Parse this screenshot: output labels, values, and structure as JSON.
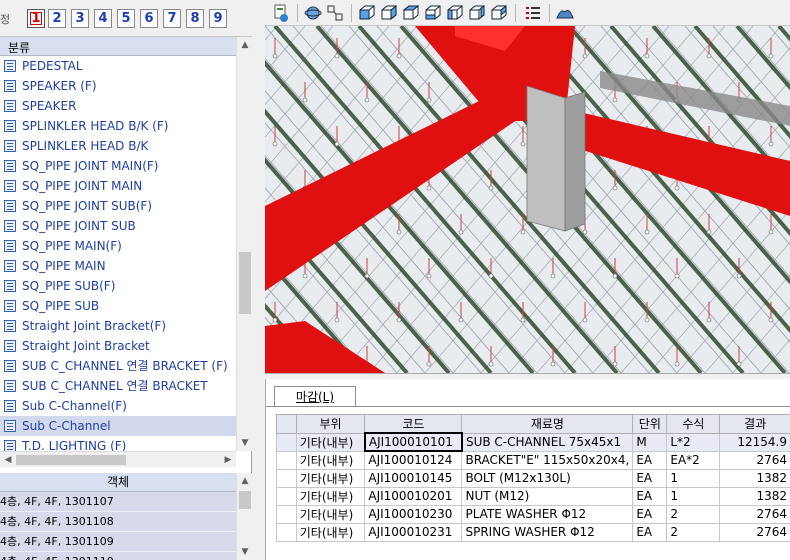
{
  "floor_bar": {
    "label": "정",
    "buttons": [
      "1",
      "2",
      "3",
      "4",
      "5",
      "6",
      "7",
      "8",
      "9"
    ],
    "active": "1"
  },
  "tree": {
    "header": "분류",
    "items": [
      "PEDESTAL",
      "SPEAKER (F)",
      "SPEAKER",
      "SPLINKLER HEAD B/K (F)",
      "SPLINKLER HEAD B/K",
      "SQ_PIPE JOINT MAIN(F)",
      "SQ_PIPE JOINT MAIN",
      "SQ_PIPE JOINT SUB(F)",
      "SQ_PIPE JOINT SUB",
      "SQ_PIPE MAIN(F)",
      "SQ_PIPE MAIN",
      "SQ_PIPE SUB(F)",
      "SQ_PIPE SUB",
      "Straight Joint Bracket(F)",
      "Straight Joint Bracket",
      "SUB C_CHANNEL 연결 BRACKET (F)",
      "SUB C_CHANNEL 연결 BRACKET",
      "Sub C-Channel(F)",
      "Sub C-Channel",
      "T.D. LIGHTING (F)"
    ],
    "selected_index": 18
  },
  "objects": {
    "header": "객체",
    "rows": [
      "4층, 4F, 4F, 1301107",
      "4층, 4F, 4F, 1301108",
      "4층, 4F, 4F, 1301109",
      "4층, 4F, 4F, 1301110"
    ]
  },
  "icons": {
    "toolbar": [
      "export-icon",
      "orbit-icon",
      "pan-icon",
      "cube-view-icon-1",
      "cube-view-icon-2",
      "cube-view-icon-3",
      "cube-view-icon-4",
      "cube-view-icon-5",
      "cube-view-icon-6",
      "cube-view-icon-7",
      "list-icon",
      "terrain-icon"
    ]
  },
  "bottom_panel": {
    "tab_label": "마감(L)",
    "columns": [
      "부위",
      "코드",
      "재료명",
      "단위",
      "수식",
      "결과"
    ],
    "rows": [
      {
        "part": "기타(내부)",
        "code": "AJI100010101",
        "material": "SUB C-CHANNEL  75x45x1",
        "unit": "M",
        "formula": "L*2",
        "result": "12154.9"
      },
      {
        "part": "기타(내부)",
        "code": "AJI100010124",
        "material": "BRACKET\"E\"  115x50x20x4,",
        "unit": "EA",
        "formula": "EA*2",
        "result": "2764"
      },
      {
        "part": "기타(내부)",
        "code": "AJI100010145",
        "material": "BOLT  (M12x130L)",
        "unit": "EA",
        "formula": "1",
        "result": "1382"
      },
      {
        "part": "기타(내부)",
        "code": "AJI100010201",
        "material": "NUT  (M12)",
        "unit": "EA",
        "formula": "1",
        "result": "1382"
      },
      {
        "part": "기타(내부)",
        "code": "AJI100010230",
        "material": "PLATE WASHER  Φ12",
        "unit": "EA",
        "formula": "2",
        "result": "2764"
      },
      {
        "part": "기타(내부)",
        "code": "AJI100010231",
        "material": "SPRING WASHER  Φ12",
        "unit": "EA",
        "formula": "2",
        "result": "2764"
      }
    ]
  },
  "colors": {
    "beam_red": "#e01010",
    "channel_green": "#2f4a2c",
    "tile_light": "#e9ecef",
    "column_gray": "#bfbfbf",
    "link_blue": "#1e3fa0"
  }
}
